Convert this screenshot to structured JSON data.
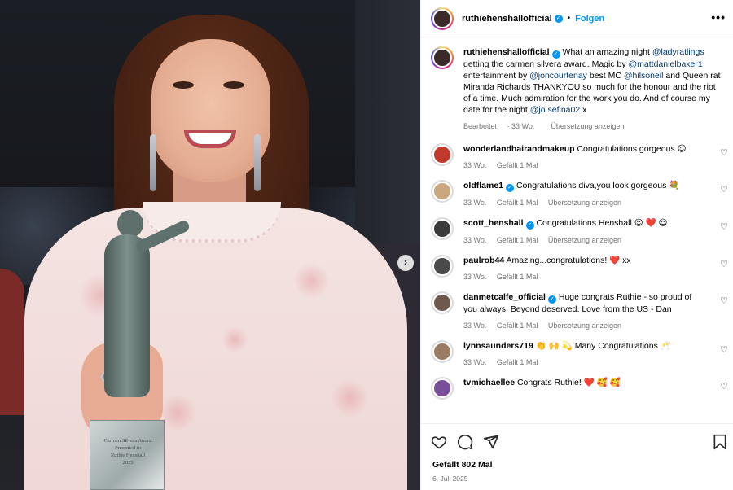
{
  "header": {
    "username": "ruthiehenshallofficial",
    "separator": "•",
    "follow_label": "Folgen",
    "more_label": "•••"
  },
  "media": {
    "trophy_engraving": [
      "Carmen Silvera Award",
      "Presented to",
      "Ruthie Henshall",
      "2025"
    ],
    "next_label": "›"
  },
  "caption": {
    "username": "ruthiehenshallofficial",
    "parts": [
      {
        "t": "What an amazing night ",
        "m": false
      },
      {
        "t": "@ladyratlings",
        "m": true
      },
      {
        "t": " getting the carmen silvera award. Magic by ",
        "m": false
      },
      {
        "t": "@mattdanielbaker1",
        "m": true
      },
      {
        "t": " entertainment by ",
        "m": false
      },
      {
        "t": "@joncourtenay",
        "m": true
      },
      {
        "t": " best MC ",
        "m": false
      },
      {
        "t": "@hilsoneil",
        "m": true
      },
      {
        "t": " and Queen rat Miranda Richards THANKYOU so much for the honour and the riot of a time. Much admiration for the work you do. And of course my date for the night ",
        "m": false
      },
      {
        "t": "@jo.sefina02",
        "m": true
      },
      {
        "t": " x",
        "m": false
      }
    ],
    "edited_label": "Bearbeitet",
    "time": "33 Wo.",
    "translate_label": "Übersetzung anzeigen"
  },
  "comments": [
    {
      "username": "wonderlandhairandmakeup",
      "verified": false,
      "text": "Congratulations gorgeous 😍",
      "time": "33 Wo.",
      "likes": "Gefällt 1 Mal",
      "translate": "",
      "avatar_color": "#c0392b"
    },
    {
      "username": "oldflame1",
      "verified": true,
      "text": "Congratulations diva,you look gorgeous 💐",
      "time": "33 Wo.",
      "likes": "Gefällt 1 Mal",
      "translate": "Übersetzung anzeigen",
      "avatar_color": "#caa77e"
    },
    {
      "username": "scott_henshall",
      "verified": true,
      "text": "Congratulations Henshall 😍 ❤️ 😍",
      "time": "33 Wo.",
      "likes": "Gefällt 1 Mal",
      "translate": "Übersetzung anzeigen",
      "avatar_color": "#3b3b3b"
    },
    {
      "username": "paulrob44",
      "verified": false,
      "text": "Amazing...congratulations! ❤️ xx",
      "time": "33 Wo.",
      "likes": "Gefällt 1 Mal",
      "translate": "",
      "avatar_color": "#4a4a4a"
    },
    {
      "username": "danmetcalfe_official",
      "verified": true,
      "text": "Huge congrats Ruthie - so proud of you always. Beyond deserved. Love from the US - Dan",
      "time": "33 Wo.",
      "likes": "Gefällt 1 Mal",
      "translate": "Übersetzung anzeigen",
      "avatar_color": "#6d5a4c"
    },
    {
      "username": "lynnsaunders719",
      "verified": false,
      "text": "👏 🙌 💫 Many Congratulations 🥂",
      "time": "33 Wo.",
      "likes": "Gefällt 1 Mal",
      "translate": "",
      "avatar_color": "#9a7b63"
    },
    {
      "username": "tvmichaellee",
      "verified": false,
      "text": "Congrats Ruthie! ❤️ 🥰 🥰",
      "time": "",
      "likes": "",
      "translate": "",
      "avatar_color": "#7a4f9a"
    }
  ],
  "icons": {
    "like": "heart-icon",
    "comment": "comment-icon",
    "share": "share-icon",
    "save": "bookmark-icon",
    "comment_like": "♡"
  },
  "footer": {
    "likes": "Gefällt 802 Mal",
    "date": "6. Juli 2025"
  },
  "colors": {
    "accent": "#0095f6",
    "mention": "#00376b",
    "secondary_text": "#737373"
  }
}
